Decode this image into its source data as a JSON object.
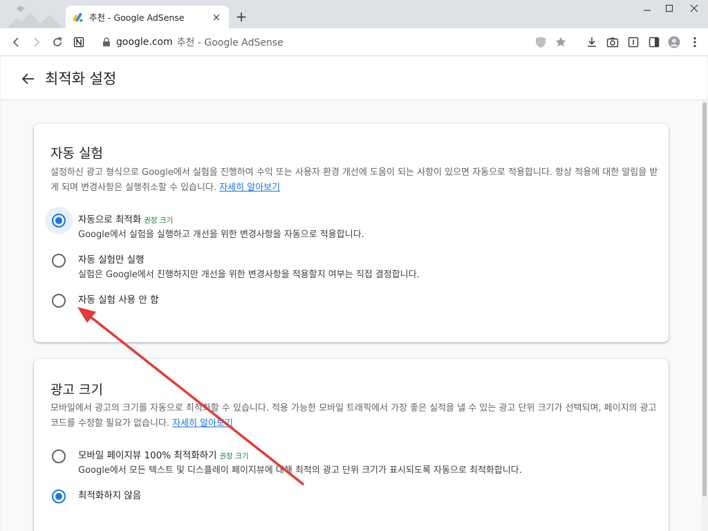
{
  "browser": {
    "tab_title": "추천 - Google AdSense",
    "url_domain": "google.com",
    "url_rest": "추천 - Google AdSense"
  },
  "page": {
    "title": "최적화 설정"
  },
  "auto_experiments": {
    "title": "자동 실험",
    "description": "설정하신 광고 형식으로 Google에서 실험을 진행하여 수익 또는 사용자 환경 개선에 도움이 되는 사항이 있으면 자동으로 적용합니다. 항상 적용에 대한 알림을 받게 되며 변경사항은 실행취소할 수 있습니다.",
    "learn_more": "자세히 알아보기",
    "options": [
      {
        "label": "자동으로 최적화",
        "badge": "권장 크기",
        "desc": "Google에서 실험을 실행하고 개선을 위한 변경사항을 자동으로 적용합니다.",
        "checked": true
      },
      {
        "label": "자동 실험만 실행",
        "badge": "",
        "desc": "실험은 Google에서 진행하지만 개선을 위한 변경사항을 적용할지 여부는 직접 결정합니다.",
        "checked": false
      },
      {
        "label": "자동 실험 사용 안 함",
        "badge": "",
        "desc": "",
        "checked": false
      }
    ]
  },
  "ad_size": {
    "title": "광고 크기",
    "description": "모바일에서 광고의 크기를 자동으로 최적화할 수 있습니다. 적용 가능한 모바일 트래픽에서 가장 좋은 실적을 낼 수 있는 광고 단위 크기가 선택되며, 페이지의 광고 코드를 수정할 필요가 없습니다.",
    "learn_more": "자세히 알아보기",
    "options": [
      {
        "label": "모바일 페이지뷰 100% 최적화하기",
        "badge": "권장 크기",
        "desc": "Google에서 모든 텍스트 및 디스플레이 페이지뷰에 대해 최적의 광고 단위 크기가 표시되도록 자동으로 최적화합니다.",
        "checked": false
      },
      {
        "label": "최적화하지 않음",
        "badge": "",
        "desc": "",
        "checked": true
      }
    ]
  },
  "colors": {
    "accent": "#1a73e8",
    "badge_green": "#188038",
    "annotation_arrow": "#e53935"
  }
}
